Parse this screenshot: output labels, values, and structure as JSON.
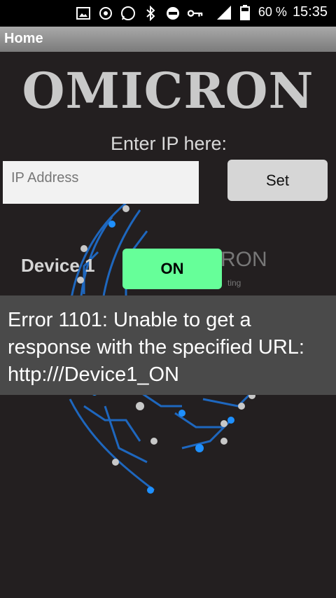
{
  "status_bar": {
    "icons": [
      "image-icon",
      "sync-icon",
      "whatsapp-icon",
      "bluetooth-icon",
      "do-not-disturb-icon",
      "key-icon",
      "signal-icon",
      "battery-icon"
    ],
    "battery_percent": "60 %",
    "time": "15:35"
  },
  "action_bar": {
    "title": "Home"
  },
  "main": {
    "brand_title": "OMICRON",
    "ip_label": "Enter IP here:",
    "ip_input": {
      "value": "",
      "placeholder": "IP Address"
    },
    "set_button": "Set",
    "device_label": "Device 1",
    "on_button": "ON",
    "background_logo_text": "RON",
    "background_logo_subtext": "ting"
  },
  "toast": {
    "message": "Error 1101: Unable to get a response with the specified URL: http:///Device1_ON"
  },
  "colors": {
    "background": "#231f20",
    "on_button": "#66ff99",
    "accent_blue": "#1e90ff"
  }
}
